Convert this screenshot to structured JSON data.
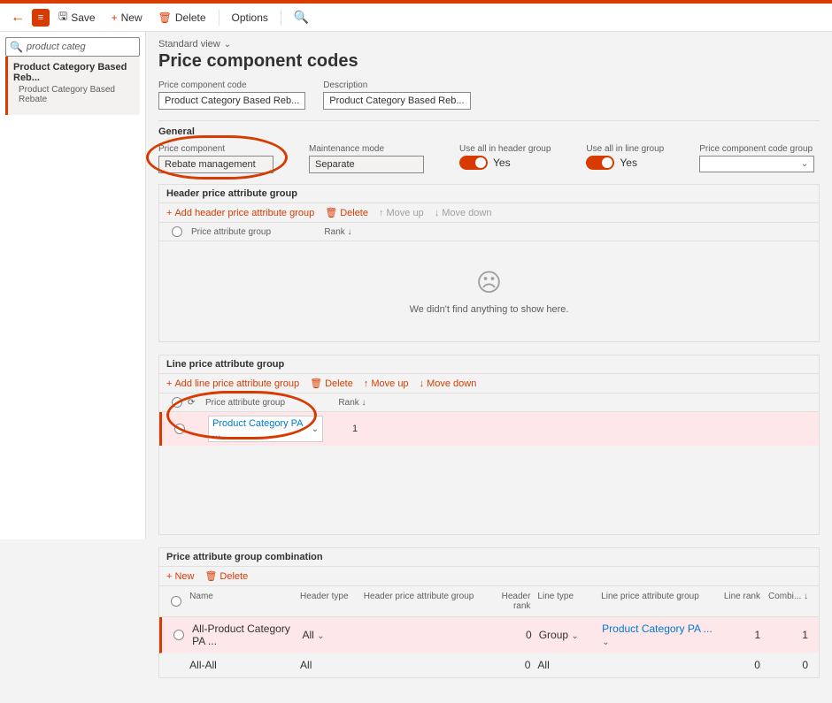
{
  "toolbar": {
    "save": "Save",
    "new": "New",
    "delete": "Delete",
    "options": "Options"
  },
  "sidebar": {
    "search_value": "product categ",
    "items": [
      {
        "label": "Product Category Based Reb...",
        "sub": "Product Category Based Rebate"
      }
    ]
  },
  "header": {
    "view_label": "Standard view",
    "title": "Price component codes",
    "code_label": "Price component code",
    "code_value": "Product Category Based Reb...",
    "desc_label": "Description",
    "desc_value": "Product Category Based Reb..."
  },
  "general": {
    "title": "General",
    "price_component_label": "Price component",
    "price_component_value": "Rebate management",
    "maintenance_label": "Maintenance mode",
    "maintenance_value": "Separate",
    "use_header_label": "Use all in header group",
    "use_header_value": "Yes",
    "use_line_label": "Use all in line group",
    "use_line_value": "Yes",
    "code_group_label": "Price component code group",
    "code_group_value": ""
  },
  "header_group": {
    "title": "Header price attribute group",
    "add": "Add header price attribute group",
    "delete": "Delete",
    "move_up": "Move up",
    "move_down": "Move down",
    "col_name": "Price attribute group",
    "col_rank": "Rank",
    "empty_msg": "We didn't find anything to show here."
  },
  "line_group": {
    "title": "Line price attribute group",
    "add": "Add line price attribute group",
    "delete": "Delete",
    "move_up": "Move up",
    "move_down": "Move down",
    "col_name": "Price attribute group",
    "col_rank": "Rank",
    "rows": [
      {
        "name": "Product Category PA ...",
        "rank": "1"
      }
    ]
  },
  "combination": {
    "title": "Price attribute group combination",
    "new": "New",
    "delete": "Delete",
    "cols": {
      "name": "Name",
      "header_type": "Header type",
      "header_group": "Header price attribute group",
      "header_rank": "Header rank",
      "line_type": "Line type",
      "line_group": "Line price attribute group",
      "line_rank": "Line rank",
      "combi": "Combi..."
    },
    "rows": [
      {
        "name": "All-Product Category PA ...",
        "header_type": "All",
        "header_group": "",
        "header_rank": "0",
        "line_type": "Group",
        "line_group": "Product Category PA ...",
        "line_rank": "1",
        "combi": "1"
      },
      {
        "name": "All-All",
        "header_type": "All",
        "header_group": "",
        "header_rank": "0",
        "line_type": "All",
        "line_group": "",
        "line_rank": "0",
        "combi": "0"
      }
    ]
  }
}
